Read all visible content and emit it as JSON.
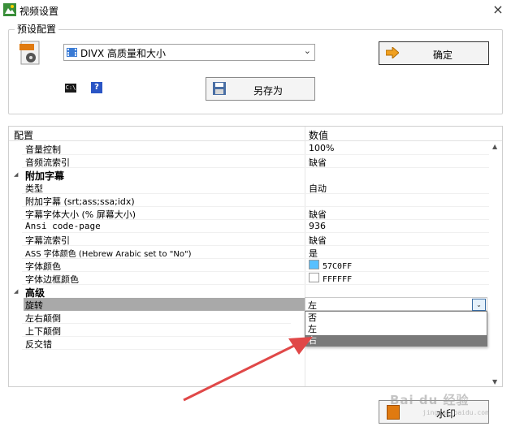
{
  "window": {
    "title": "视频设置",
    "close_glyph": "×"
  },
  "preset_group": {
    "legend": "预设配置",
    "preset_select_value": "DIVX 高质量和大小",
    "ok_label": "确定",
    "saveas_label": "另存为",
    "cmd_icon_text": "C:\\"
  },
  "grid": {
    "col_config": "配置",
    "col_value": "数值",
    "rows": [
      {
        "name": "音量控制",
        "value": "100%"
      },
      {
        "name": "音频流索引",
        "value": "缺省"
      },
      {
        "name": "附加字幕"
      },
      {
        "name": "类型",
        "value": "自动"
      },
      {
        "name": "附加字幕 (srt;ass;ssa;idx)",
        "value": ""
      },
      {
        "name": "字幕字体大小 (% 屏幕大小)",
        "value": "缺省"
      },
      {
        "name": "Ansi code-page",
        "value": "936"
      },
      {
        "name": "字幕流索引",
        "value": "缺省"
      },
      {
        "name": "ASS 字体颜色 (Hebrew Arabic set to \"No\")",
        "value": "是"
      },
      {
        "name": "字体颜色",
        "value": "57C0FF",
        "color": "#57C0FF"
      },
      {
        "name": "字体边框颜色",
        "value": "FFFFFF",
        "color": "#FFFFFF"
      },
      {
        "name": "高级"
      },
      {
        "name": "旋转",
        "value": "左"
      },
      {
        "name": "左右颠倒"
      },
      {
        "name": "上下颠倒"
      },
      {
        "name": "反交错"
      }
    ]
  },
  "dropdown": {
    "current": "左",
    "options": [
      "否",
      "左",
      "右"
    ],
    "highlighted_index": 2
  },
  "watermark_label": "水印",
  "brand": {
    "mark": "Bai du 经验",
    "sub": "jingyan.baidu.com"
  },
  "colors": {
    "font_color": "#57C0FF",
    "border_color": "#FFFFFF",
    "annotation_arrow": "#e04848"
  }
}
